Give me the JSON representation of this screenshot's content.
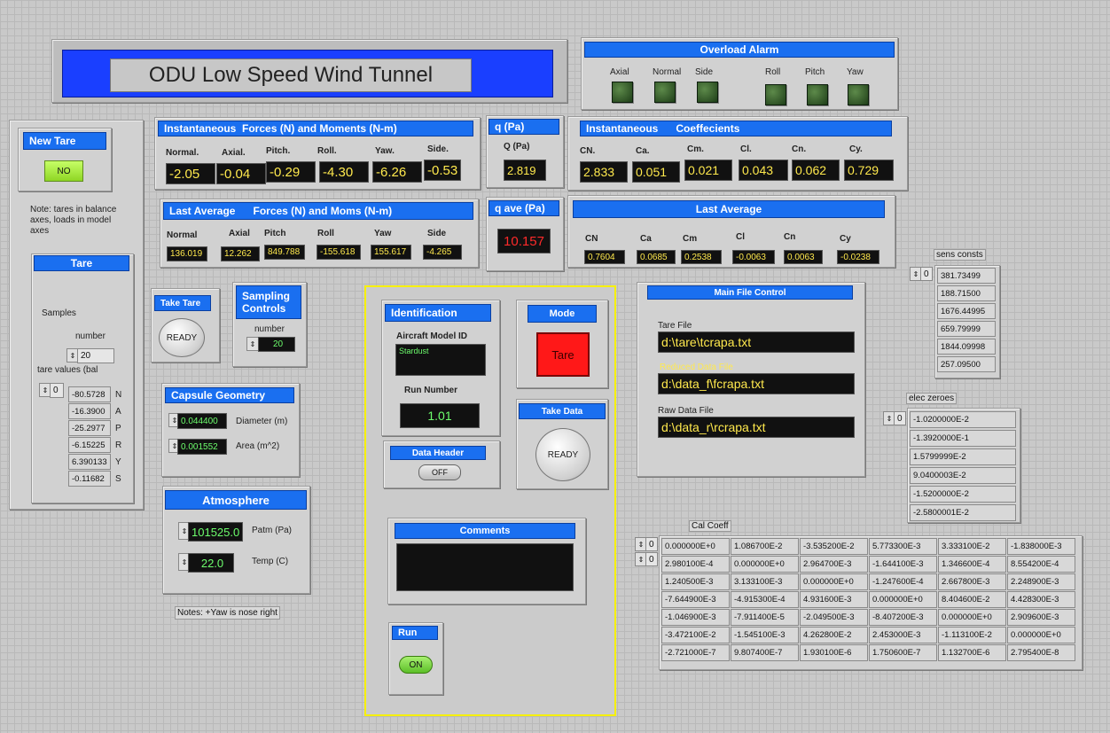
{
  "title": "ODU Low Speed Wind Tunnel",
  "overload_alarm": {
    "header": "Overload Alarm",
    "labels": [
      "Axial",
      "Normal",
      "Side",
      "Roll",
      "Pitch",
      "Yaw"
    ]
  },
  "new_tare": {
    "header": "New Tare",
    "value": "NO"
  },
  "tare_note": "Note: tares in balance axes, loads in model axes",
  "instant_forces": {
    "header": "Instantaneous  Forces (N) and Moments (N-m)",
    "labels": [
      "Normal.",
      "Axial.",
      "Pitch.",
      "Roll.",
      "Yaw.",
      "Side."
    ],
    "values": [
      "-2.05",
      "-0.04",
      "-0.29",
      "-4.30",
      "-6.26",
      "-0.53"
    ]
  },
  "q": {
    "header": "q (Pa)",
    "label": "Q (Pa)",
    "value": "2.819"
  },
  "instant_coeff": {
    "header": "Instantaneous      Coeffecients",
    "labels": [
      "CN.",
      "Ca.",
      "Cm.",
      "Cl.",
      "Cn.",
      "Cy."
    ],
    "values": [
      "2.833",
      "0.051",
      "0.021",
      "0.043",
      "0.062",
      "0.729"
    ]
  },
  "last_avg_forces": {
    "header": "Last Average      Forces (N) and Moms (N-m)",
    "labels": [
      "Normal",
      "Axial",
      "Pitch",
      "Roll",
      "Yaw",
      "Side"
    ],
    "values": [
      "136.019",
      "12.262",
      "849.788",
      "-155.618",
      "155.617",
      "-4.265"
    ]
  },
  "q_ave": {
    "header": "q ave (Pa)",
    "value": "10.157"
  },
  "last_avg_coeff": {
    "header": "Last Average",
    "labels": [
      "CN",
      "Ca",
      "Cm",
      "Cl",
      "Cn",
      "Cy"
    ],
    "values": [
      "0.7604",
      "0.0685",
      "0.2538",
      "-0.0063",
      "0.0063",
      "-0.0238"
    ]
  },
  "tare": {
    "header": "Tare",
    "samples_label": "Samples",
    "number_label": "number",
    "number_value": "20",
    "tare_values_label": "tare values (bal",
    "index": "0",
    "values": [
      "-80.5728",
      "-16.3900",
      "-25.2977",
      "-6.15225",
      "6.390133",
      "-0.11682"
    ],
    "axes": [
      "N",
      "A",
      "P",
      "R",
      "Y",
      "S"
    ]
  },
  "take_tare": {
    "header": "Take Tare",
    "button": "READY"
  },
  "sampling": {
    "header": "Sampling Controls",
    "number_label": "number",
    "value": "20"
  },
  "capsule": {
    "header": "Capsule Geometry",
    "diameter_value": "0.044400",
    "diameter_label": "Diameter (m)",
    "area_value": "0.001552",
    "area_label": "Area (m^2)"
  },
  "atmosphere": {
    "header": "Atmosphere",
    "patm_value": "101525.0",
    "patm_label": "Patm (Pa)",
    "temp_value": "22.0",
    "temp_label": "Temp (C)"
  },
  "yaw_note": "Notes: +Yaw is nose right",
  "identification": {
    "header": "Identification",
    "model_label": "Aircraft Model ID",
    "model_value": "Stardust",
    "run_label": "Run Number",
    "run_value": "1.01"
  },
  "mode": {
    "header": "Mode",
    "value": "Tare"
  },
  "take_data": {
    "header": "Take Data",
    "button": "READY"
  },
  "data_header": {
    "header": "Data Header",
    "toggle": "OFF"
  },
  "comments": {
    "header": "Comments"
  },
  "run": {
    "header": "Run",
    "toggle": "ON"
  },
  "file_control": {
    "header": "Main File Control",
    "tare_label": "Tare File",
    "tare_path": "d:\\tare\\tcrapa.txt",
    "reduced_label": "Reduced Data File",
    "reduced_path": "d:\\data_f\\fcrapa.txt",
    "raw_label": "Raw Data File",
    "raw_path": "d:\\data_r\\rcrapa.txt"
  },
  "sens_consts": {
    "label": "sens consts",
    "index": "0",
    "values": [
      "381.73499",
      "188.71500",
      "1676.44995",
      "659.79999",
      "1844.09998",
      "257.09500"
    ]
  },
  "elec_zeroes": {
    "label": "elec zeroes",
    "index": "0",
    "values": [
      "-1.0200000E-2",
      "-1.3920000E-1",
      "1.5799999E-2",
      "9.0400003E-2",
      "-1.5200000E-2",
      "-2.5800001E-2"
    ]
  },
  "cal_coeff": {
    "label": "Cal Coeff",
    "index1": "0",
    "index2": "0",
    "rows": [
      [
        "0.000000E+0",
        "1.086700E-2",
        "-3.535200E-2",
        "5.773300E-3",
        "3.333100E-2",
        "-1.838000E-3"
      ],
      [
        "2.980100E-4",
        "0.000000E+0",
        "2.964700E-3",
        "-1.644100E-3",
        "1.346600E-4",
        "8.554200E-4"
      ],
      [
        "1.240500E-3",
        "3.133100E-3",
        "0.000000E+0",
        "-1.247600E-4",
        "2.667800E-3",
        "2.248900E-3"
      ],
      [
        "-7.644900E-3",
        "-4.915300E-4",
        "4.931600E-3",
        "0.000000E+0",
        "8.404600E-2",
        "4.428300E-3"
      ],
      [
        "-1.046900E-3",
        "-7.911400E-5",
        "-2.049500E-3",
        "-8.407200E-3",
        "0.000000E+0",
        "2.909600E-3"
      ],
      [
        "-3.472100E-2",
        "-1.545100E-3",
        "4.262800E-2",
        "2.453000E-3",
        "-1.113100E-2",
        "0.000000E+0"
      ],
      [
        "-2.721000E-7",
        "9.807400E-7",
        "1.930100E-6",
        "1.750600E-7",
        "1.132700E-6",
        "2.795400E-8"
      ]
    ]
  }
}
